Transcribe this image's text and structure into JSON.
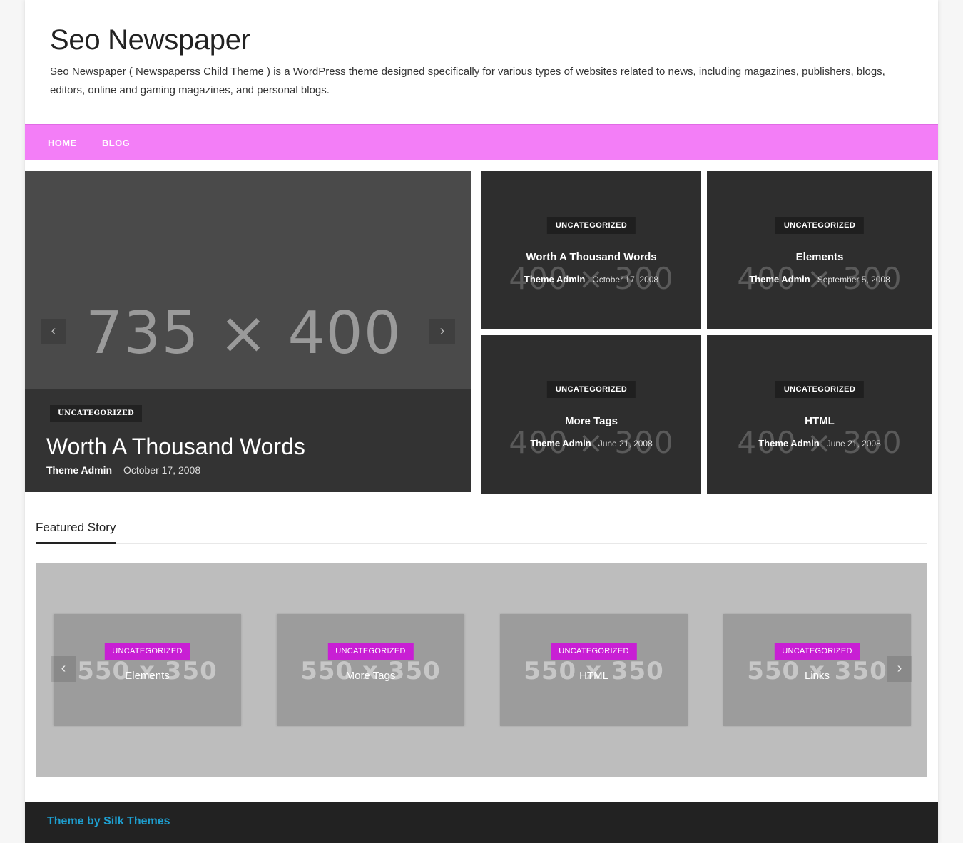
{
  "site": {
    "title": "Seo Newspaper",
    "description": "Seo Newspaper ( Newspaperss Child Theme ) is a WordPress theme designed specifically for various types of websites related to news, including magazines, publishers, blogs, editors, online and gaming magazines, and personal blogs."
  },
  "nav": {
    "items": [
      {
        "label": "HOME"
      },
      {
        "label": "BLOG"
      }
    ],
    "color": "#f37ef7"
  },
  "hero": {
    "image_text": "735 × 400",
    "category": "UNCATEGORIZED",
    "title": "Worth A Thousand Words",
    "author": "Theme Admin",
    "date": "October 17, 2008",
    "prev_icon": "chevron-left-icon",
    "next_icon": "chevron-right-icon"
  },
  "tiles": [
    {
      "image_text": "400 × 300",
      "category": "UNCATEGORIZED",
      "title": "Worth A Thousand Words",
      "author": "Theme Admin",
      "date": "October 17, 2008"
    },
    {
      "image_text": "400 × 300",
      "category": "UNCATEGORIZED",
      "title": "Elements",
      "author": "Theme Admin",
      "date": "September 5, 2008"
    },
    {
      "image_text": "400 × 300",
      "category": "UNCATEGORIZED",
      "title": "More Tags",
      "author": "Theme Admin",
      "date": "June 21, 2008"
    },
    {
      "image_text": "400 × 300",
      "category": "UNCATEGORIZED",
      "title": "HTML",
      "author": "Theme Admin",
      "date": "June 21, 2008"
    }
  ],
  "featured": {
    "heading": "Featured Story",
    "cards": [
      {
        "image_text": "550 x 350",
        "category": "UNCATEGORIZED",
        "title": "Elements"
      },
      {
        "image_text": "550 x 350",
        "category": "UNCATEGORIZED",
        "title": "More Tags"
      },
      {
        "image_text": "550 x 350",
        "category": "UNCATEGORIZED",
        "title": "HTML"
      },
      {
        "image_text": "550 x 350",
        "category": "UNCATEGORIZED",
        "title": "Links"
      }
    ],
    "accent": "#c81fd4"
  },
  "footer": {
    "credit": "Theme by Silk Themes",
    "link_color": "#1e9fd0"
  }
}
